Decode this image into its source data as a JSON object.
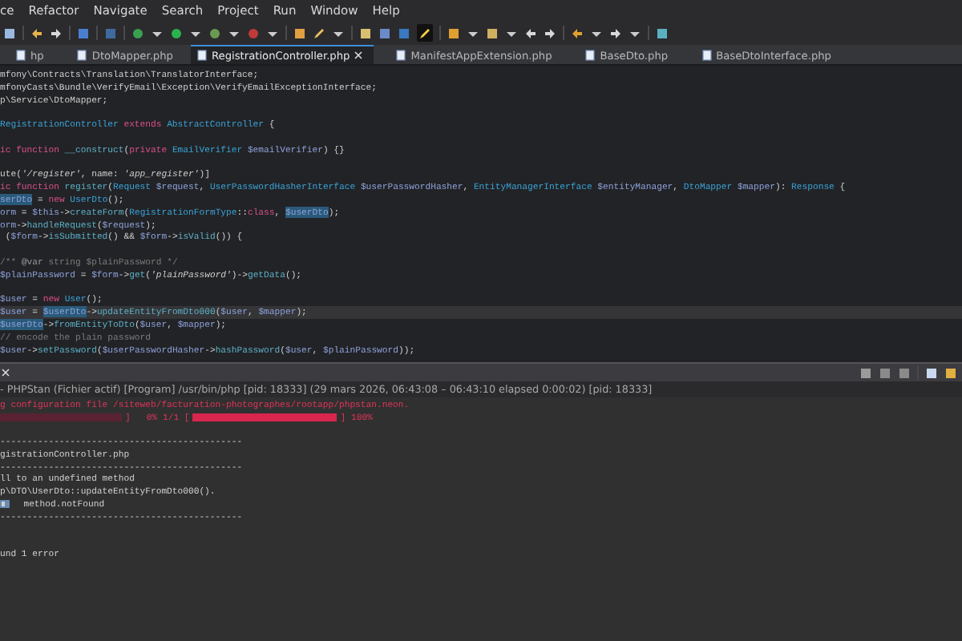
{
  "menu": [
    "ce",
    "Refactor",
    "Navigate",
    "Search",
    "Project",
    "Run",
    "Window",
    "Help"
  ],
  "toolbar": {
    "toggle_on": true
  },
  "tabs": [
    {
      "label": "hp",
      "selected": false,
      "closable": false
    },
    {
      "label": "DtoMapper.php",
      "selected": false,
      "closable": false
    },
    {
      "label": "RegistrationController.php",
      "selected": true,
      "closable": true
    },
    {
      "label": "ManifestAppExtension.php",
      "selected": false,
      "closable": false
    },
    {
      "label": "BaseDto.php",
      "selected": false,
      "closable": false
    },
    {
      "label": "BaseDtoInterface.php",
      "selected": false,
      "closable": false
    }
  ],
  "code_lines": [
    {
      "current": false,
      "segments": [
        {
          "kind": "plain",
          "text": "mfony\\Contracts\\Translation\\TranslatorInterface;"
        }
      ]
    },
    {
      "current": false,
      "segments": [
        {
          "kind": "plain",
          "text": "mfonyCasts\\Bundle\\VerifyEmail\\Exception\\VerifyEmailExceptionInterface;"
        }
      ]
    },
    {
      "current": false,
      "segments": [
        {
          "kind": "plain",
          "text": "p\\Service\\DtoMapper;"
        }
      ]
    },
    {
      "current": false
    },
    {
      "current": false,
      "segments": [
        {
          "kind": "type",
          "text": "RegistrationController"
        },
        {
          "kind": "keyword",
          "text": " extends "
        },
        {
          "kind": "type",
          "text": "AbstractController"
        },
        {
          "kind": "plain",
          "text": " {"
        }
      ]
    },
    {
      "current": false
    },
    {
      "current": false,
      "segments": [
        {
          "kind": "keyword",
          "text": "ic function "
        },
        {
          "kind": "function",
          "text": "__construct"
        },
        {
          "kind": "plain",
          "text": "("
        },
        {
          "kind": "keyword",
          "text": "private "
        },
        {
          "kind": "type",
          "text": "EmailVerifier "
        },
        {
          "kind": "variable",
          "text": "$emailVerifier"
        },
        {
          "kind": "plain",
          "text": ") {}"
        }
      ]
    },
    {
      "current": false
    },
    {
      "current": false,
      "segments": [
        {
          "kind": "plain",
          "text": "ute("
        },
        {
          "kind": "string",
          "text": "'/register'"
        },
        {
          "kind": "plain",
          "text": ", name: "
        },
        {
          "kind": "string",
          "text": "'app_register'"
        },
        {
          "kind": "plain",
          "text": ")]"
        }
      ]
    },
    {
      "current": false,
      "segments": [
        {
          "kind": "keyword",
          "text": "ic function "
        },
        {
          "kind": "function",
          "text": "register"
        },
        {
          "kind": "plain",
          "text": "("
        },
        {
          "kind": "type",
          "text": "Request "
        },
        {
          "kind": "variable",
          "text": "$request"
        },
        {
          "kind": "plain",
          "text": ", "
        },
        {
          "kind": "type",
          "text": "UserPasswordHasherInterface "
        },
        {
          "kind": "variable",
          "text": "$userPasswordHasher"
        },
        {
          "kind": "plain",
          "text": ", "
        },
        {
          "kind": "type",
          "text": "EntityManagerInterface "
        },
        {
          "kind": "variable",
          "text": "$entityManager"
        },
        {
          "kind": "plain",
          "text": ", "
        },
        {
          "kind": "type",
          "text": "DtoMapper "
        },
        {
          "kind": "variable",
          "text": "$mapper"
        },
        {
          "kind": "plain",
          "text": "): "
        },
        {
          "kind": "type",
          "text": "Response"
        },
        {
          "kind": "plain",
          "text": " {"
        }
      ]
    },
    {
      "current": false,
      "segments": [
        {
          "kind": "variable",
          "text": "serDto",
          "marked": true
        },
        {
          "kind": "plain",
          "text": " = "
        },
        {
          "kind": "keyword",
          "text": "new "
        },
        {
          "kind": "type",
          "text": "UserDto"
        },
        {
          "kind": "plain",
          "text": "();"
        }
      ]
    },
    {
      "current": false,
      "segments": [
        {
          "kind": "variable",
          "text": "orm"
        },
        {
          "kind": "plain",
          "text": " = "
        },
        {
          "kind": "variable",
          "text": "$this"
        },
        {
          "kind": "plain",
          "text": "->"
        },
        {
          "kind": "function",
          "text": "createForm"
        },
        {
          "kind": "plain",
          "text": "("
        },
        {
          "kind": "type",
          "text": "RegistrationFormType"
        },
        {
          "kind": "plain",
          "text": "::"
        },
        {
          "kind": "keyword",
          "text": "class"
        },
        {
          "kind": "plain",
          "text": ", "
        },
        {
          "kind": "variable",
          "text": "$userDto",
          "marked": true
        },
        {
          "kind": "plain",
          "text": ");"
        }
      ]
    },
    {
      "current": false,
      "segments": [
        {
          "kind": "variable",
          "text": "orm"
        },
        {
          "kind": "plain",
          "text": "->"
        },
        {
          "kind": "function",
          "text": "handleRequest"
        },
        {
          "kind": "plain",
          "text": "("
        },
        {
          "kind": "variable",
          "text": "$request"
        },
        {
          "kind": "plain",
          "text": ");"
        }
      ]
    },
    {
      "current": false,
      "segments": [
        {
          "kind": "plain",
          "text": " ("
        },
        {
          "kind": "variable",
          "text": "$form"
        },
        {
          "kind": "plain",
          "text": "->"
        },
        {
          "kind": "function",
          "text": "isSubmitted"
        },
        {
          "kind": "plain",
          "text": "() && "
        },
        {
          "kind": "variable",
          "text": "$form"
        },
        {
          "kind": "plain",
          "text": "->"
        },
        {
          "kind": "function",
          "text": "isValid"
        },
        {
          "kind": "plain",
          "text": "()) {"
        }
      ]
    },
    {
      "current": false
    },
    {
      "current": false,
      "segments": [
        {
          "kind": "comment",
          "text": "/** "
        },
        {
          "kind": "doctag",
          "text": "@var"
        },
        {
          "kind": "comment",
          "text": " string $plainPassword */"
        }
      ]
    },
    {
      "current": false,
      "segments": [
        {
          "kind": "variable",
          "text": "$plainPassword"
        },
        {
          "kind": "plain",
          "text": " = "
        },
        {
          "kind": "variable",
          "text": "$form"
        },
        {
          "kind": "plain",
          "text": "->"
        },
        {
          "kind": "function",
          "text": "get"
        },
        {
          "kind": "plain",
          "text": "("
        },
        {
          "kind": "string",
          "text": "'plainPassword'"
        },
        {
          "kind": "plain",
          "text": ")->"
        },
        {
          "kind": "function",
          "text": "getData"
        },
        {
          "kind": "plain",
          "text": "();"
        }
      ]
    },
    {
      "current": false
    },
    {
      "current": false,
      "segments": [
        {
          "kind": "variable",
          "text": "$user"
        },
        {
          "kind": "plain",
          "text": " = "
        },
        {
          "kind": "keyword",
          "text": "new "
        },
        {
          "kind": "type",
          "text": "User"
        },
        {
          "kind": "plain",
          "text": "();"
        }
      ]
    },
    {
      "current": true,
      "segments": [
        {
          "kind": "variable",
          "text": "$user"
        },
        {
          "kind": "plain",
          "text": " = "
        },
        {
          "kind": "variable",
          "text": "$userDto",
          "marked": true
        },
        {
          "kind": "plain",
          "text": "->"
        },
        {
          "kind": "function",
          "text": "updateEntityFromDto000"
        },
        {
          "kind": "plain",
          "text": "("
        },
        {
          "kind": "variable",
          "text": "$user"
        },
        {
          "kind": "plain",
          "text": ", "
        },
        {
          "kind": "variable",
          "text": "$mapper"
        },
        {
          "kind": "plain",
          "text": ");"
        }
      ]
    },
    {
      "current": false,
      "segments": [
        {
          "kind": "variable",
          "text": "$userDto",
          "marked": true
        },
        {
          "kind": "plain",
          "text": "->"
        },
        {
          "kind": "function",
          "text": "fromEntityToDto"
        },
        {
          "kind": "plain",
          "text": "("
        },
        {
          "kind": "variable",
          "text": "$user"
        },
        {
          "kind": "plain",
          "text": ", "
        },
        {
          "kind": "variable",
          "text": "$mapper"
        },
        {
          "kind": "plain",
          "text": ");"
        }
      ]
    },
    {
      "current": false,
      "segments": [
        {
          "kind": "comment",
          "text": "// encode the plain password"
        }
      ]
    },
    {
      "current": false,
      "segments": [
        {
          "kind": "variable",
          "text": "$user"
        },
        {
          "kind": "plain",
          "text": "->"
        },
        {
          "kind": "function",
          "text": "setPassword"
        },
        {
          "kind": "plain",
          "text": "("
        },
        {
          "kind": "variable",
          "text": "$userPasswordHasher"
        },
        {
          "kind": "plain",
          "text": "->"
        },
        {
          "kind": "function",
          "text": "hashPassword"
        },
        {
          "kind": "plain",
          "text": "("
        },
        {
          "kind": "variable",
          "text": "$user"
        },
        {
          "kind": "plain",
          "text": ", "
        },
        {
          "kind": "variable",
          "text": "$plainPassword"
        },
        {
          "kind": "plain",
          "text": "));"
        }
      ]
    }
  ],
  "console": {
    "title": "- PHPStan (Fichier actif) [Program] /usr/bin/php [pid: 18333] (29 mars 2026, 06:43:08 – 06:43:10 elapsed 0:00:02) [pid: 18333]",
    "lines": [
      {
        "kind": "error",
        "text": "g configuration file /siteweb/facturation-photographes/rootapp/phpstan.neon."
      },
      {
        "kind": "progress",
        "parts": [
          {
            "kind": "bar",
            "level": 0
          },
          {
            "kind": "text",
            "text": "]   0% 1/1 ["
          },
          {
            "kind": "bar",
            "level": 1
          },
          {
            "kind": "text",
            "text": "] 100%"
          }
        ]
      },
      {
        "kind": "blank"
      },
      {
        "kind": "text",
        "text": "---------------------------------------------"
      },
      {
        "kind": "text",
        "text": "gistrationController.php"
      },
      {
        "kind": "text",
        "text": "---------------------------------------------"
      },
      {
        "kind": "text",
        "text": "ll to an undefined method"
      },
      {
        "kind": "text",
        "text": "p\\DTO\\UserDto::updateEntityFromDto000()."
      },
      {
        "kind": "identifier",
        "text": "method.notFound"
      },
      {
        "kind": "text",
        "text": "---------------------------------------------"
      },
      {
        "kind": "blank"
      },
      {
        "kind": "blank"
      },
      {
        "kind": "text",
        "text": "und 1 error"
      }
    ]
  }
}
